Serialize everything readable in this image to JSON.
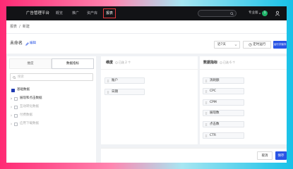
{
  "header": {
    "brand": "广告管理平台",
    "nav": [
      {
        "label": "概览",
        "active": false
      },
      {
        "label": "推广",
        "active": false
      },
      {
        "label": "资产库",
        "active": false
      },
      {
        "label": "报表",
        "active": true
      }
    ],
    "account_label": "专业版",
    "avatar_text": "1"
  },
  "breadcrumb": {
    "items": [
      "报表",
      "新建"
    ],
    "separator": "/"
  },
  "report": {
    "title": "未命名",
    "edit_label": "编辑"
  },
  "toolbar": {
    "date_range": "近7天",
    "schedule_label": "定时运行",
    "run_label": "运行并保存"
  },
  "field_panel": {
    "tabs": [
      {
        "label": "维度",
        "active": false
      },
      {
        "label": "数据指标",
        "active": true
      }
    ],
    "search_placeholder": "搜索",
    "groups": [
      {
        "label": "基础数据",
        "checked": true,
        "expandable": false
      },
      {
        "label": "展现和点击数据",
        "checked": false,
        "expandable": true
      },
      {
        "label": "互动转化数据",
        "checked": false,
        "expandable": true
      },
      {
        "label": "付费数据",
        "checked": false,
        "expandable": true
      },
      {
        "label": "应用下载数据",
        "checked": false,
        "expandable": true
      }
    ]
  },
  "selection": {
    "dimensions": {
      "title": "维度",
      "count_text": "已选 2 个",
      "items": [
        "账户",
        "日期"
      ]
    },
    "metrics": {
      "title": "数据指标",
      "count_text": "已选 6 个",
      "items": [
        "消耗额",
        "CPC",
        "CPM",
        "展现数",
        "点击数",
        "CTR"
      ]
    }
  },
  "footer": {
    "cancel_label": "取消",
    "save_label": "保存"
  },
  "colors": {
    "primary": "#2a55e5",
    "header_bg": "#121316",
    "active_nav_outline": "#e4393c",
    "avatar": "#1fb46a",
    "checkbox_checked": "#1f3bb3"
  },
  "icons": {
    "edit": "pencil-icon",
    "search": "search-icon",
    "dropdown": "chevron-down-icon",
    "schedule": "clock-icon",
    "expand": "chevron-right-icon",
    "drag": "drag-handle-icon",
    "info": "info-icon",
    "user": "user-icon"
  }
}
